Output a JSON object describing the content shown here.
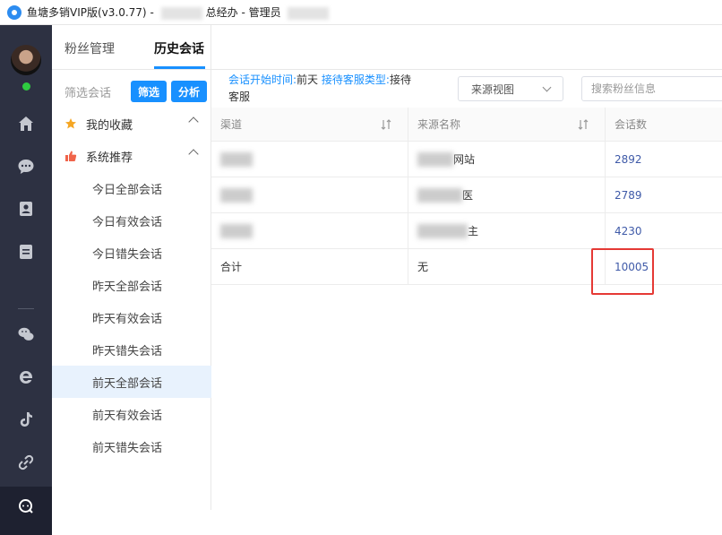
{
  "window": {
    "title_prefix": "鱼塘多销VIP版(v3.0.77)",
    "title_mid": "总经办",
    "title_suffix": "- 管理员"
  },
  "rail": {
    "icons": [
      "home-icon",
      "chat-icon",
      "contacts-icon",
      "notes-icon",
      "wechat-icon",
      "ie-browser-icon",
      "tiktok-icon",
      "link-icon",
      "support-chat-icon"
    ]
  },
  "tabs": [
    {
      "label": "粉丝管理"
    },
    {
      "label": "历史会话"
    }
  ],
  "sidebar": {
    "filter_label": "筛选会话",
    "filter_button": "筛选",
    "analyze_button": "分析",
    "favorites": "我的收藏",
    "recommended": "系统推荐",
    "items": [
      {
        "label": "今日全部会话"
      },
      {
        "label": "今日有效会话"
      },
      {
        "label": "今日错失会话"
      },
      {
        "label": "昨天全部会话"
      },
      {
        "label": "昨天有效会话"
      },
      {
        "label": "昨天错失会话"
      },
      {
        "label": "前天全部会话"
      },
      {
        "label": "前天有效会话"
      },
      {
        "label": "前天错失会话"
      }
    ],
    "active_index": 6
  },
  "criteria": {
    "start_time_key": "会话开始时间:",
    "start_time_value": "前天",
    "agent_type_key": "接待客服类型:",
    "agent_type_value": "接待客服"
  },
  "source_select": {
    "value": "来源视图"
  },
  "search": {
    "placeholder": "搜索粉丝信息",
    "value": ""
  },
  "table": {
    "headers": [
      "渠道",
      "来源名称",
      "会话数"
    ],
    "rows": [
      {
        "source_visible": "网站",
        "count": "2892"
      },
      {
        "source_visible": "医",
        "count": "2789"
      },
      {
        "source_visible": "主",
        "count": "4230"
      }
    ],
    "total": {
      "channel": "合计",
      "source": "无",
      "count": "10005"
    }
  },
  "colors": {
    "accent": "#1890ff",
    "rail_bg": "#2d3142",
    "highlight_border": "#e53935",
    "count_text": "#3f5aa8"
  }
}
